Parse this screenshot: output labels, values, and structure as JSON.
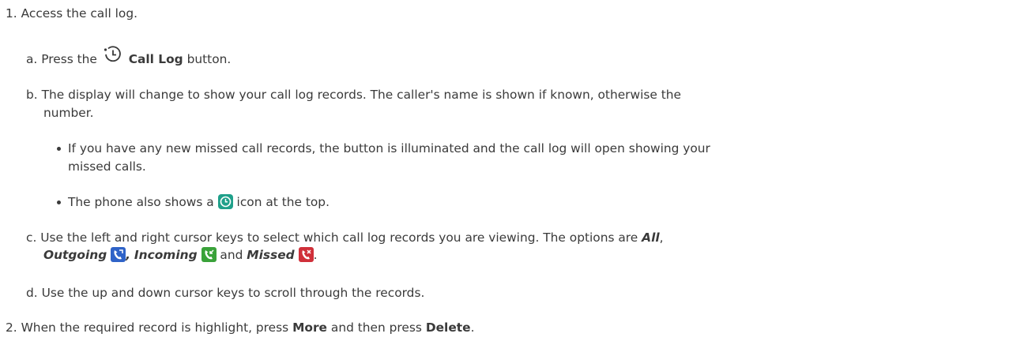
{
  "steps": [
    {
      "number": "1.",
      "text": "Access the call log.",
      "substeps": [
        {
          "letter": "a.",
          "pre": "Press the",
          "bold": "Call Log",
          "post": "button."
        },
        {
          "letter": "b.",
          "line1": "The display will change to show your call log records. The caller's name is shown if known, otherwise the",
          "line2": "number.",
          "bullets": [
            {
              "line1": "If you have any new missed call records, the button is illuminated and the call log will open showing your",
              "line2": "missed calls."
            },
            {
              "pre": "The phone also shows a",
              "post": "icon at the top."
            }
          ]
        },
        {
          "letter": "c.",
          "line1_pre": "Use the left and right cursor keys to select which call log records you are viewing. The options are",
          "opt_all": "All",
          "comma": ",",
          "opt_outgoing": "Outgoing",
          "comma2": ",",
          "opt_incoming": "Incoming",
          "and": "and",
          "opt_missed": "Missed",
          "period": "."
        },
        {
          "letter": "d.",
          "text": "Use the up and down cursor keys to scroll through the records."
        }
      ]
    },
    {
      "number": "2.",
      "pre": "When the required record is highlight, press",
      "bold1": "More",
      "mid": "and then press",
      "bold2": "Delete",
      "post": "."
    }
  ],
  "colors": {
    "text": "#3a3a3a",
    "outgoing_icon": "#2f63c8",
    "incoming_icon": "#3aa23a",
    "missed_icon": "#d0303a",
    "missed_status_icon": "#1fa08a"
  },
  "icons": [
    "clock-history-icon",
    "missed-call-status-icon",
    "outgoing-call-icon",
    "incoming-call-icon",
    "missed-call-icon"
  ]
}
